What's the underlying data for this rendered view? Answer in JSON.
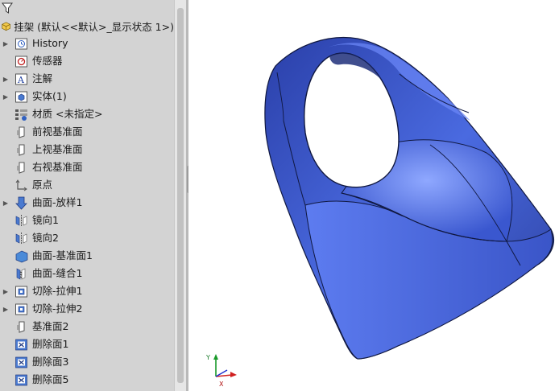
{
  "tree": {
    "root_label": "挂架 (默认<<默认>_显示状态 1>)",
    "items": [
      {
        "label": "History",
        "icon": "history-icon",
        "expandable": true
      },
      {
        "label": "传感器",
        "icon": "sensor-icon",
        "expandable": false
      },
      {
        "label": "注解",
        "icon": "annotation-icon",
        "expandable": true
      },
      {
        "label": "实体(1)",
        "icon": "solid-body-icon",
        "expandable": true
      },
      {
        "label": "材质 <未指定>",
        "icon": "material-icon",
        "expandable": false
      },
      {
        "label": "前视基准面",
        "icon": "plane-icon",
        "expandable": false
      },
      {
        "label": "上视基准面",
        "icon": "plane-icon",
        "expandable": false
      },
      {
        "label": "右视基准面",
        "icon": "plane-icon",
        "expandable": false
      },
      {
        "label": "原点",
        "icon": "origin-icon",
        "expandable": false
      },
      {
        "label": "曲面-放样1",
        "icon": "surface-loft-icon",
        "expandable": true
      },
      {
        "label": "镜向1",
        "icon": "mirror-icon",
        "expandable": false
      },
      {
        "label": "镜向2",
        "icon": "mirror-icon",
        "expandable": false
      },
      {
        "label": "曲面-基准面1",
        "icon": "planar-surface-icon",
        "expandable": false
      },
      {
        "label": "曲面-缝合1",
        "icon": "knit-surface-icon",
        "expandable": false
      },
      {
        "label": "切除-拉伸1",
        "icon": "extrude-cut-icon",
        "expandable": true
      },
      {
        "label": "切除-拉伸2",
        "icon": "extrude-cut-icon",
        "expandable": true
      },
      {
        "label": "基准面2",
        "icon": "plane-icon",
        "expandable": false
      },
      {
        "label": "删除面1",
        "icon": "delete-face-icon",
        "expandable": false
      },
      {
        "label": "删除面3",
        "icon": "delete-face-icon",
        "expandable": false
      },
      {
        "label": "删除面5",
        "icon": "delete-face-icon",
        "expandable": false
      }
    ]
  },
  "triad": {
    "y_label": "Y",
    "x_label": "X"
  },
  "colors": {
    "panel_bg": "#d3d3d3",
    "model_blue": "#3d5bd0",
    "model_edge": "#101840"
  }
}
